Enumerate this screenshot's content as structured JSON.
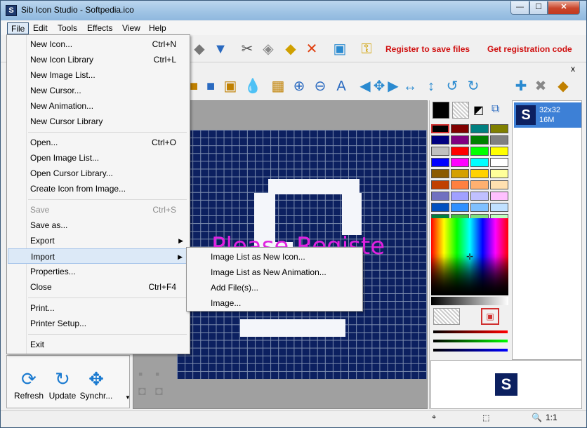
{
  "window": {
    "title": "Sib Icon Studio - Softpedia.ico",
    "app_icon_letter": "S",
    "minimize": "—",
    "maximize": "☐",
    "close": "✕"
  },
  "menubar": [
    "File",
    "Edit",
    "Tools",
    "Effects",
    "View",
    "Help"
  ],
  "toolbar": {
    "register_save": "Register to save files",
    "get_registration": "Get registration code",
    "panel_close": "x"
  },
  "file_menu": [
    {
      "label": "New Icon...",
      "shortcut": "Ctrl+N"
    },
    {
      "label": "New Icon Library",
      "shortcut": "Ctrl+L"
    },
    {
      "label": "New Image List...",
      "shortcut": ""
    },
    {
      "label": "New Cursor...",
      "shortcut": ""
    },
    {
      "label": "New Animation...",
      "shortcut": ""
    },
    {
      "label": "New Cursor Library",
      "shortcut": ""
    },
    {
      "label": "Open...",
      "shortcut": "Ctrl+O"
    },
    {
      "label": "Open Image List...",
      "shortcut": ""
    },
    {
      "label": "Open Cursor Library...",
      "shortcut": ""
    },
    {
      "label": "Create Icon from Image...",
      "shortcut": ""
    },
    {
      "label": "Save",
      "shortcut": "Ctrl+S"
    },
    {
      "label": "Save as...",
      "shortcut": ""
    },
    {
      "label": "Export",
      "shortcut": ""
    },
    {
      "label": "Import",
      "shortcut": ""
    },
    {
      "label": "Properties...",
      "shortcut": ""
    },
    {
      "label": "Close",
      "shortcut": "Ctrl+F4"
    },
    {
      "label": "Print...",
      "shortcut": ""
    },
    {
      "label": "Printer Setup...",
      "shortcut": ""
    },
    {
      "label": "Exit",
      "shortcut": ""
    }
  ],
  "import_submenu": [
    "Image List as New Icon...",
    "Image List as New Animation...",
    "Add File(s)...",
    "Image..."
  ],
  "bottom_buttons": [
    "Refresh",
    "Update",
    "Synchr..."
  ],
  "canvas_overlay": "Please Registe",
  "icon_list": {
    "entry_letter": "S",
    "size": "32x32",
    "colors": "16M"
  },
  "statusbar": {
    "zoom": "1:1"
  },
  "palette_colors": [
    "#000000",
    "#800000",
    "#008080",
    "#808000",
    "#000080",
    "#800080",
    "#008000",
    "#808080",
    "#c0c0c0",
    "#ff0000",
    "#00ff00",
    "#ffff00",
    "#0000ff",
    "#ff00ff",
    "#00ffff",
    "#ffffff",
    "#8b5a00",
    "#d4a000",
    "#ffd200",
    "#ffff99",
    "#c04000",
    "#ff8040",
    "#ffb070",
    "#ffe0b0",
    "#7070c0",
    "#a0a0ff",
    "#c0c0ff",
    "#ffc0ff",
    "#0050c0",
    "#3090ff",
    "#80c0ff",
    "#c0e0ff",
    "#008040",
    "#40c040",
    "#80e080",
    "#c0ffc0"
  ]
}
